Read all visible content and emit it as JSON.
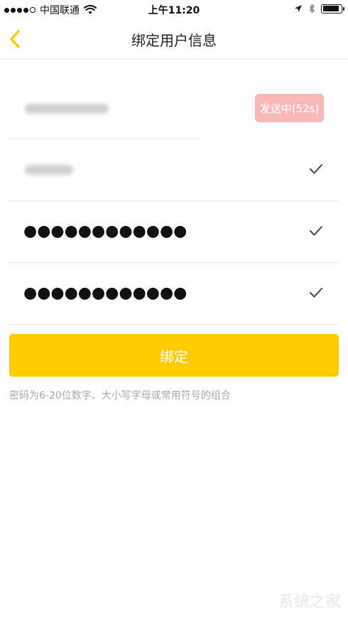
{
  "status_bar": {
    "carrier": "中国联通",
    "time": "上午11:20",
    "battery_percent": 90
  },
  "nav": {
    "title": "绑定用户信息"
  },
  "form": {
    "phone_field": {
      "masked": true
    },
    "send_button_label": "发送中(52s)",
    "code_field": {
      "masked": true
    },
    "password_field": {
      "value": "●●●●●●●●●●●●"
    },
    "confirm_password_field": {
      "value": "●●●●●●●●●●●●"
    }
  },
  "bind_button_label": "绑定",
  "hint": "密码为6-20位数字、大小写字母或常用符号的组合",
  "watermark": "系统之家",
  "colors": {
    "accent": "#fecb00",
    "send_button": "#f9b8b8",
    "hint_text": "#a8a8a8",
    "divider": "#e6e6e6"
  }
}
